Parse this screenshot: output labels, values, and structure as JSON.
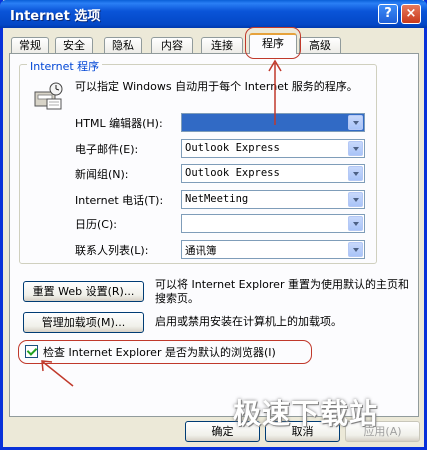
{
  "window": {
    "title": "Internet 选项",
    "help_label": "?",
    "close_label": "×"
  },
  "tabs": [
    "常规",
    "安全",
    "隐私",
    "内容",
    "连接",
    "程序",
    "高级"
  ],
  "active_tab": "程序",
  "programs_group": {
    "label": "Internet 程序",
    "description": "可以指定 Windows 自动用于每个 Internet 服务的程序。",
    "rows": [
      {
        "label": "HTML 编辑器(H):",
        "value": ""
      },
      {
        "label": "电子邮件(E):",
        "value": "Outlook Express"
      },
      {
        "label": "新闻组(N):",
        "value": "Outlook Express"
      },
      {
        "label": "Internet 电话(T):",
        "value": "NetMeeting"
      },
      {
        "label": "日历(C):",
        "value": ""
      },
      {
        "label": "联系人列表(L):",
        "value": "通讯簿"
      }
    ]
  },
  "reset_web": {
    "label": "重置 Web 设置(R)...",
    "description": "可以将 Internet Explorer 重置为使用默认的主页和搜索页。"
  },
  "manage_addons": {
    "label": "管理加载项(M)...",
    "description": "启用或禁用安装在计算机上的加载项。"
  },
  "default_check": {
    "label": "检查 Internet Explorer 是否为默认的浏览器(I)",
    "checked": true
  },
  "footer": {
    "ok": "确定",
    "cancel": "取消",
    "apply": "应用(A)"
  },
  "watermark": "极速下载站",
  "colors": {
    "title_blue": "#0a54d8",
    "annotation_red": "#c0392b",
    "selection_blue": "#316ac5"
  }
}
